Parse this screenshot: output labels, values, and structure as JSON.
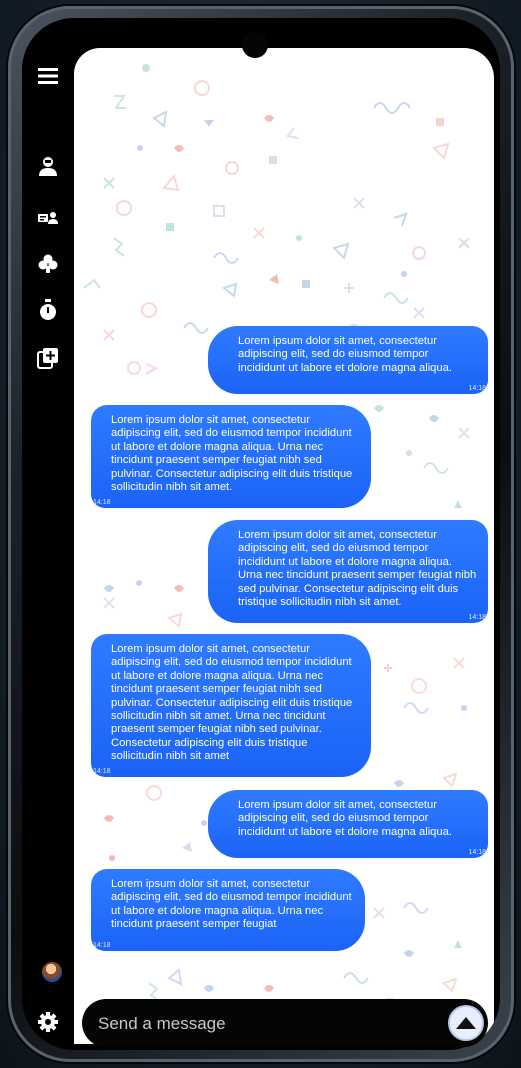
{
  "sidebar": {
    "icons": [
      "menu-icon",
      "user-shield-icon",
      "contacts-card-icon",
      "puzzle-icon",
      "stopwatch-icon",
      "add-copy-icon",
      "avatar",
      "gear-icon"
    ]
  },
  "messages": [
    {
      "direction": "out",
      "text": "Lorem ipsum dolor sit amet, consectetur adipiscing elit, sed do eiusmod tempor incididunt ut labore et dolore magna aliqua.",
      "time": "14:18"
    },
    {
      "direction": "in",
      "text": "Lorem ipsum dolor sit amet, consectetur adipiscing elit, sed do eiusmod tempor incididunt ut labore et dolore magna aliqua. Urna nec tincidunt praesent semper feugiat nibh sed pulvinar. Consectetur adipiscing elit duis tristique sollicitudin nibh sit amet.",
      "time": "14:18"
    },
    {
      "direction": "out",
      "text": "Lorem ipsum dolor sit amet, consectetur adipiscing elit, sed do eiusmod tempor incididunt ut labore et dolore magna aliqua. Urna nec tincidunt praesent semper feugiat nibh sed pulvinar. Consectetur adipiscing elit duis tristique sollicitudin nibh sit amet.",
      "time": "14:18"
    },
    {
      "direction": "in",
      "text": "Lorem ipsum dolor sit amet, consectetur adipiscing elit, sed do eiusmod tempor incididunt ut labore et dolore magna aliqua. Urna nec tincidunt praesent semper feugiat nibh sed pulvinar. Consectetur adipiscing elit duis tristique sollicitudin nibh sit amet. Urna nec tincidunt praesent semper feugiat nibh sed pulvinar. Consectetur adipiscing elit duis tristique sollicitudin nibh sit amet",
      "time": "14:18"
    },
    {
      "direction": "out",
      "text": "Lorem ipsum dolor sit amet, consectetur adipiscing elit, sed do eiusmod tempor incididunt ut labore et dolore magna aliqua.",
      "time": "14:18"
    },
    {
      "direction": "in",
      "text": "Lorem ipsum dolor sit amet, consectetur adipiscing elit, sed do eiusmod tempor incididunt ut labore et dolore magna aliqua. Urna nec tincidunt praesent semper feugiat",
      "time": "14:18"
    }
  ],
  "composer": {
    "placeholder": "Send a message"
  },
  "colors": {
    "bubble": "#1f68f8",
    "background": "#ffffff",
    "frame": "#000000"
  }
}
